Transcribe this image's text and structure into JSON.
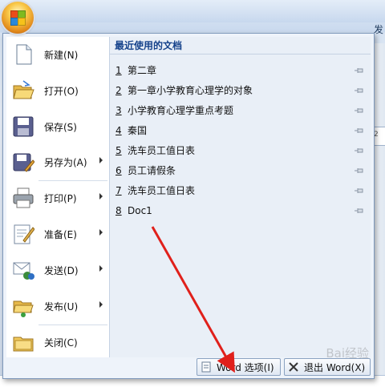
{
  "window": {
    "title_fragment": "发",
    "ruler_fragment": "2"
  },
  "menu": {
    "items": [
      {
        "label": "新建(N)",
        "has_submenu": false,
        "icon": "new-document-icon"
      },
      {
        "label": "打开(O)",
        "has_submenu": false,
        "icon": "open-folder-icon"
      },
      {
        "label": "保存(S)",
        "has_submenu": false,
        "icon": "save-disk-icon"
      },
      {
        "label": "另存为(A)",
        "has_submenu": true,
        "icon": "save-as-icon"
      },
      {
        "label": "打印(P)",
        "has_submenu": true,
        "icon": "printer-icon"
      },
      {
        "label": "准备(E)",
        "has_submenu": true,
        "icon": "prepare-icon"
      },
      {
        "label": "发送(D)",
        "has_submenu": true,
        "icon": "send-icon"
      },
      {
        "label": "发布(U)",
        "has_submenu": true,
        "icon": "publish-icon"
      },
      {
        "label": "关闭(C)",
        "has_submenu": false,
        "icon": "close-folder-icon"
      }
    ]
  },
  "recent": {
    "header": "最近使用的文档",
    "items": [
      {
        "num": "1",
        "name": "第二章"
      },
      {
        "num": "2",
        "name": "第一章小学教育心理学的对象"
      },
      {
        "num": "3",
        "name": "小学教育心理学重点考题"
      },
      {
        "num": "4",
        "name": "秦国"
      },
      {
        "num": "5",
        "name": "洗车员工值日表"
      },
      {
        "num": "6",
        "name": "员工请假条"
      },
      {
        "num": "7",
        "name": "洗车员工值日表"
      },
      {
        "num": "8",
        "name": "Doc1"
      }
    ]
  },
  "bottom": {
    "options_label": "Word 选项(I)",
    "exit_label": "退出 Word(X)"
  },
  "colors": {
    "menu_border": "#7e98bb",
    "recent_header": "#15428b",
    "annotation_arrow": "#e0201b"
  },
  "watermark": "Bai经验"
}
